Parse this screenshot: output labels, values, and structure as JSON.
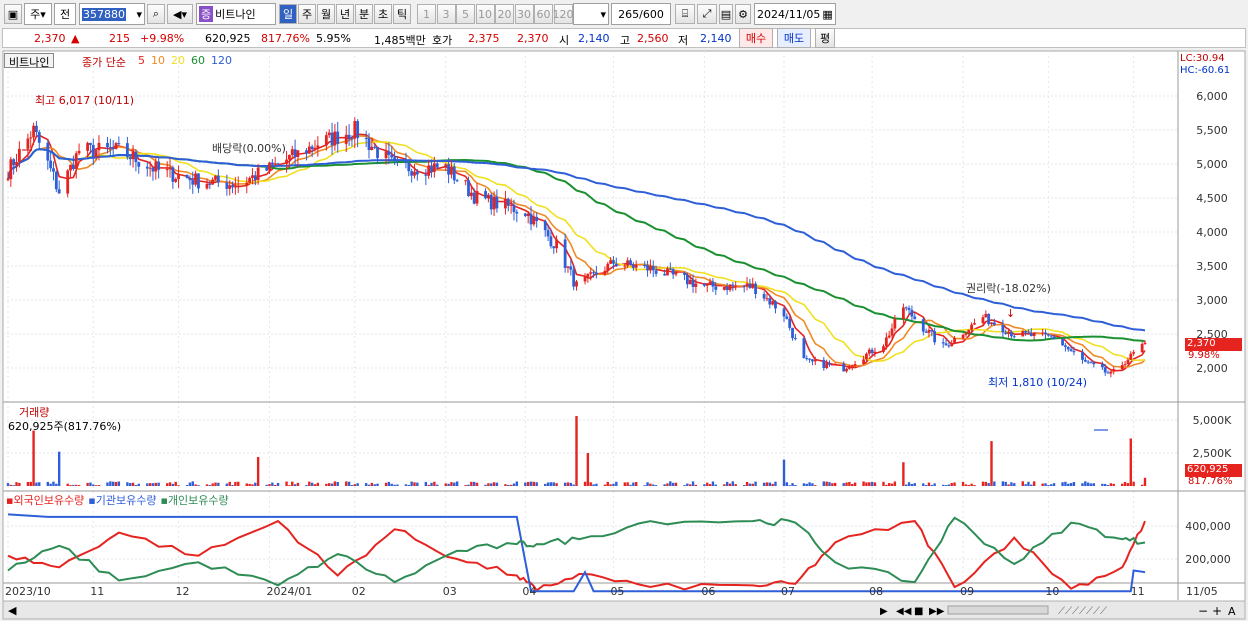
{
  "toolbar": {
    "market": "주",
    "period_prev": "전",
    "code": "357880",
    "stock_name": "비트나인",
    "stock_badge": "증",
    "period_buttons": [
      "일",
      "주",
      "월",
      "년",
      "분",
      "초",
      "틱"
    ],
    "minute_buttons": [
      "1",
      "3",
      "5",
      "10",
      "20",
      "30",
      "60",
      "120"
    ],
    "count": "265",
    "count_total": "/600",
    "date": "2024/11/05"
  },
  "quote": {
    "price": "2,370",
    "arrow": "▲",
    "change": "215",
    "change_pct": "+9.98%",
    "volume": "620,925",
    "vol_ratio": "817.76%",
    "turnover": "5.95%",
    "amount": "1,485백만",
    "bidask_label": "호가",
    "ask": "2,375",
    "bid": "2,370",
    "open_label": "시",
    "open": "2,140",
    "high_label": "고",
    "high": "2,560",
    "low_label": "저",
    "low": "2,140",
    "buy_label": "매수",
    "sell_label": "매도",
    "eval_label": "평"
  },
  "price_panel": {
    "title": "비트나인",
    "ma_label": "종가 단순",
    "ma_periods": [
      "5",
      "10",
      "20",
      "60",
      "120"
    ],
    "ma_colors": [
      "#e52420",
      "#f08a24",
      "#f0e020",
      "#1a9030",
      "#2e5fd8"
    ],
    "lc": "LC:30.94",
    "hc": "HC:-60.61",
    "annotations": {
      "high": "최고 6,017 (10/11)",
      "low": "최저 1,810 (10/24)",
      "dividend": "배당락(0.00%)",
      "rights": "권리락(-18.02%)"
    },
    "last_price": "2,370",
    "last_pct": "9.98%"
  },
  "volume_panel": {
    "title": "거래량",
    "value_label": "620,925주(817.76%)",
    "last_value": "620,925",
    "last_pct": "817.76%"
  },
  "holdings_panel": {
    "series": [
      "외국인보유수량",
      "기관보유수량",
      "개인보유수량"
    ],
    "colors": [
      "#e52420",
      "#2e5fd8",
      "#2e8c55"
    ]
  },
  "x_labels": [
    "2023/10",
    "11",
    "12",
    "2024/01",
    "02",
    "03",
    "04",
    "05",
    "06",
    "07",
    "08",
    "09",
    "10",
    "11"
  ],
  "x_last": "11/05",
  "chart_data": [
    {
      "type": "candlestick",
      "title": "비트나인",
      "y_ticks": [
        2000,
        2500,
        3000,
        3500,
        4000,
        4500,
        5000,
        5500,
        6000
      ],
      "ylim": [
        1700,
        6300
      ],
      "close_anchors": [
        {
          "x": "2023/10/02",
          "y": 4900
        },
        {
          "x": "2023/10/11",
          "y": 5500
        },
        {
          "x": "2023/10/20",
          "y": 4600
        },
        {
          "x": "2023/10/27",
          "y": 5200
        },
        {
          "x": "2023/11/10",
          "y": 5200
        },
        {
          "x": "2023/11/24",
          "y": 4900
        },
        {
          "x": "2023/12/08",
          "y": 4750
        },
        {
          "x": "2023/12/22",
          "y": 4700
        },
        {
          "x": "2024/01/05",
          "y": 5000
        },
        {
          "x": "2024/01/19",
          "y": 5300
        },
        {
          "x": "2024/02/01",
          "y": 5500
        },
        {
          "x": "2024/02/15",
          "y": 4950
        },
        {
          "x": "2024/03/04",
          "y": 4950
        },
        {
          "x": "2024/03/15",
          "y": 4500
        },
        {
          "x": "2024/04/01",
          "y": 4300
        },
        {
          "x": "2024/04/12",
          "y": 3800
        },
        {
          "x": "2024/04/19",
          "y": 3200
        },
        {
          "x": "2024/05/02",
          "y": 3550
        },
        {
          "x": "2024/05/16",
          "y": 3450
        },
        {
          "x": "2024/06/03",
          "y": 3200
        },
        {
          "x": "2024/06/20",
          "y": 3200
        },
        {
          "x": "2024/07/01",
          "y": 2800
        },
        {
          "x": "2024/07/08",
          "y": 2100
        },
        {
          "x": "2024/07/22",
          "y": 2000
        },
        {
          "x": "2024/08/05",
          "y": 2350
        },
        {
          "x": "2024/08/12",
          "y": 2900
        },
        {
          "x": "2024/08/26",
          "y": 2300
        },
        {
          "x": "2024/09/09",
          "y": 2750
        },
        {
          "x": "2024/09/20",
          "y": 2500
        },
        {
          "x": "2024/10/04",
          "y": 2450
        },
        {
          "x": "2024/10/14",
          "y": 2100
        },
        {
          "x": "2024/10/24",
          "y": 1900
        },
        {
          "x": "2024/11/05",
          "y": 2370
        }
      ]
    },
    {
      "type": "bar",
      "title": "거래량",
      "y_ticks": [
        2500000,
        5000000
      ],
      "ylim": [
        0,
        5600000
      ],
      "spikes": [
        {
          "x": "2023/10/11",
          "y": 4200000
        },
        {
          "x": "2023/10/20",
          "y": 2600000
        },
        {
          "x": "2023/12/29",
          "y": 2200000
        },
        {
          "x": "2024/04/19",
          "y": 5300000
        },
        {
          "x": "2024/04/23",
          "y": 2500000
        },
        {
          "x": "2024/07/01",
          "y": 2000000
        },
        {
          "x": "2024/08/12",
          "y": 1800000
        },
        {
          "x": "2024/09/12",
          "y": 3400000
        },
        {
          "x": "2024/10/31",
          "y": 3600000
        },
        {
          "x": "2024/11/05",
          "y": 620925
        }
      ]
    },
    {
      "type": "line",
      "title": "보유수량",
      "y_ticks": [
        200000,
        400000
      ],
      "ylim": [
        0,
        500000
      ],
      "series": [
        {
          "name": "외국인보유수량",
          "points": [
            {
              "x": "2023/10/02",
              "y": 220000
            },
            {
              "x": "2023/10/20",
              "y": 150000
            },
            {
              "x": "2023/11/10",
              "y": 360000
            },
            {
              "x": "2023/12/08",
              "y": 220000
            },
            {
              "x": "2024/01/05",
              "y": 430000
            },
            {
              "x": "2024/01/26",
              "y": 100000
            },
            {
              "x": "2024/02/15",
              "y": 380000
            },
            {
              "x": "2024/03/08",
              "y": 200000
            },
            {
              "x": "2024/03/29",
              "y": 100000
            },
            {
              "x": "2024/04/05",
              "y": 10000
            },
            {
              "x": "2024/04/20",
              "y": 110000
            },
            {
              "x": "2024/05/15",
              "y": 30000
            },
            {
              "x": "2024/06/20",
              "y": 40000
            },
            {
              "x": "2024/07/05",
              "y": 50000
            },
            {
              "x": "2024/07/19",
              "y": 300000
            },
            {
              "x": "2024/08/16",
              "y": 430000
            },
            {
              "x": "2024/08/30",
              "y": 30000
            },
            {
              "x": "2024/09/20",
              "y": 330000
            },
            {
              "x": "2024/10/10",
              "y": 20000
            },
            {
              "x": "2024/10/28",
              "y": 150000
            },
            {
              "x": "2024/11/05",
              "y": 430000
            }
          ]
        },
        {
          "name": "기관보유수량",
          "points": [
            {
              "x": "2023/10/02",
              "y": 470000
            },
            {
              "x": "2023/10/16",
              "y": 455000
            },
            {
              "x": "2024/03/29",
              "y": 455000
            },
            {
              "x": "2024/04/03",
              "y": 5000
            },
            {
              "x": "2024/04/18",
              "y": 5000
            },
            {
              "x": "2024/04/22",
              "y": 120000
            },
            {
              "x": "2024/04/25",
              "y": 5000
            },
            {
              "x": "2024/10/31",
              "y": 5000
            },
            {
              "x": "2024/11/01",
              "y": 130000
            },
            {
              "x": "2024/11/05",
              "y": 120000
            }
          ]
        },
        {
          "name": "개인보유수량",
          "points": [
            {
              "x": "2023/10/02",
              "y": 130000
            },
            {
              "x": "2023/10/20",
              "y": 280000
            },
            {
              "x": "2023/11/10",
              "y": 70000
            },
            {
              "x": "2023/12/08",
              "y": 180000
            },
            {
              "x": "2024/01/05",
              "y": 40000
            },
            {
              "x": "2024/01/26",
              "y": 230000
            },
            {
              "x": "2024/02/15",
              "y": 60000
            },
            {
              "x": "2024/03/08",
              "y": 250000
            },
            {
              "x": "2024/03/29",
              "y": 290000
            },
            {
              "x": "2024/04/05",
              "y": 290000
            },
            {
              "x": "2024/04/20",
              "y": 320000
            },
            {
              "x": "2024/05/15",
              "y": 430000
            },
            {
              "x": "2024/06/20",
              "y": 430000
            },
            {
              "x": "2024/07/05",
              "y": 420000
            },
            {
              "x": "2024/07/19",
              "y": 180000
            },
            {
              "x": "2024/08/16",
              "y": 60000
            },
            {
              "x": "2024/08/30",
              "y": 450000
            },
            {
              "x": "2024/09/20",
              "y": 170000
            },
            {
              "x": "2024/10/10",
              "y": 420000
            },
            {
              "x": "2024/10/28",
              "y": 320000
            },
            {
              "x": "2024/11/05",
              "y": 300000
            }
          ]
        }
      ]
    }
  ]
}
